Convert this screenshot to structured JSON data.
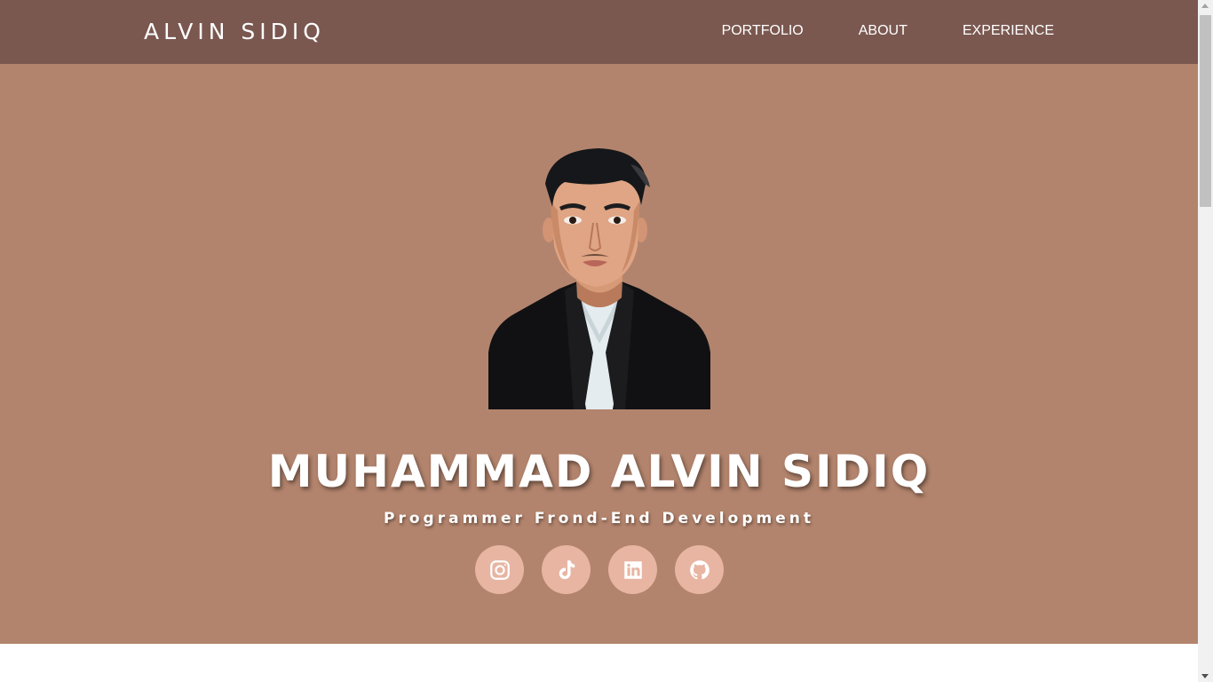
{
  "navbar": {
    "brand": "ALVIN SIDIQ",
    "links": [
      {
        "label": "PORTFOLIO"
      },
      {
        "label": "ABOUT"
      },
      {
        "label": "EXPERIENCE"
      }
    ]
  },
  "hero": {
    "title": "MUHAMMAD ALVIN SIDIQ",
    "subtitle": "Programmer Frond-End Development",
    "avatar_icon": "profile-avatar-illustration",
    "socials": [
      {
        "icon": "instagram-icon"
      },
      {
        "icon": "tiktok-icon"
      },
      {
        "icon": "linkedin-icon"
      },
      {
        "icon": "github-icon"
      }
    ]
  },
  "colors": {
    "navbar_bg": "#7a5850",
    "hero_bg": "#b3846d",
    "social_bg": "#e8b5a3",
    "text": "#ffffff"
  }
}
